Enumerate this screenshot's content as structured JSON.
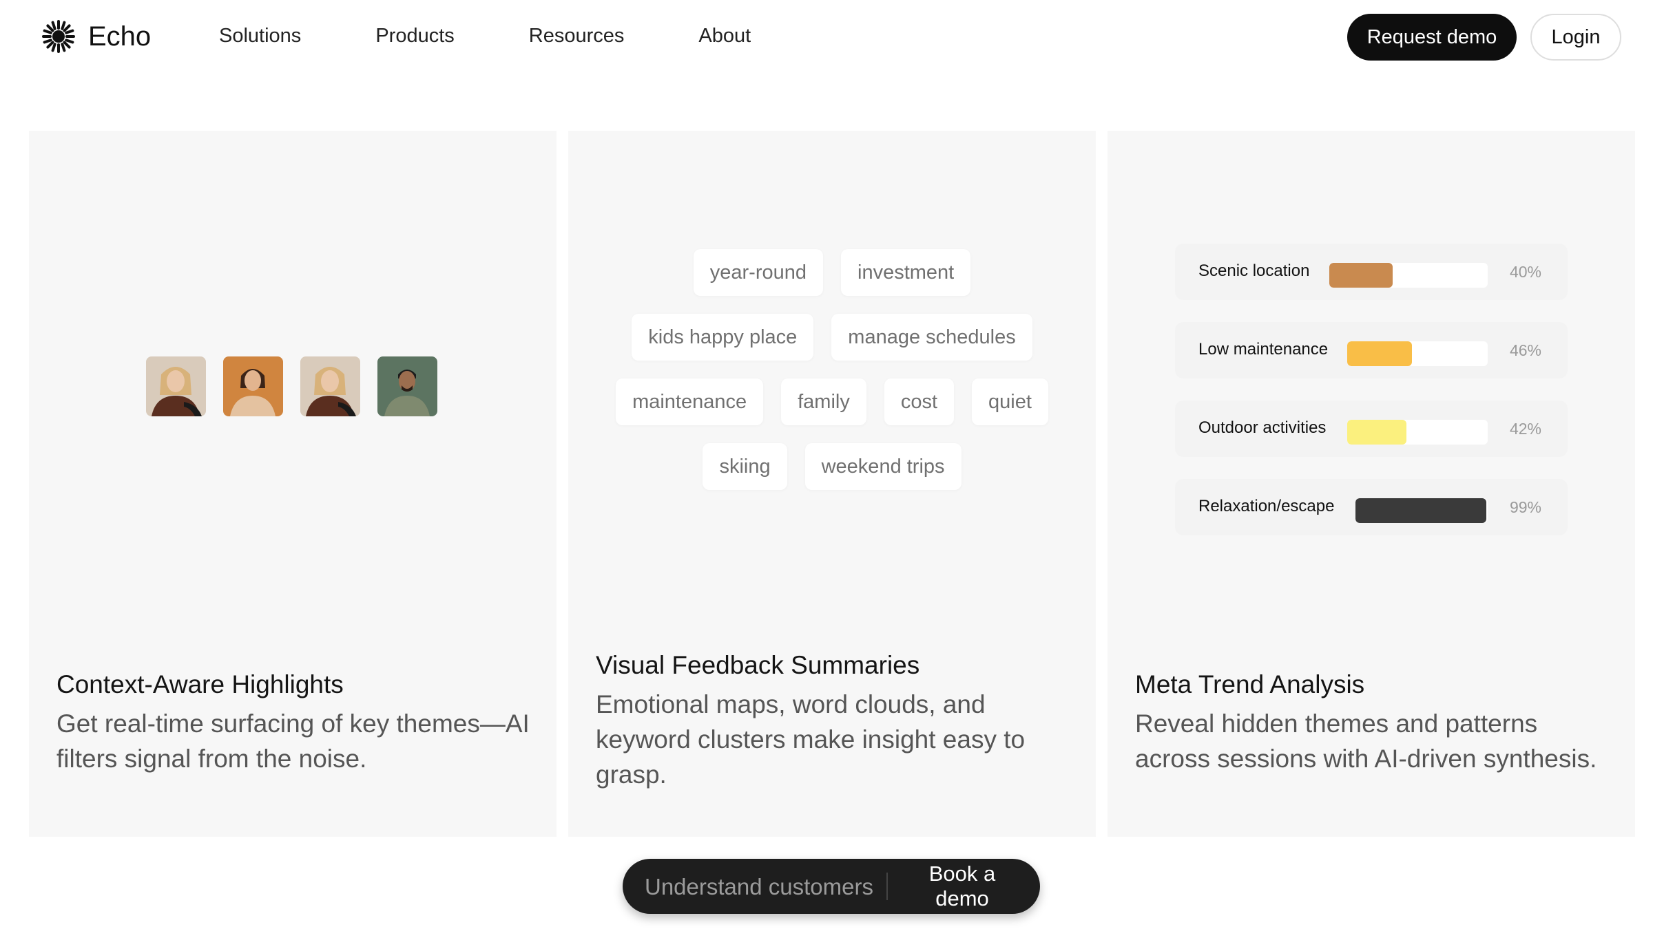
{
  "nav": {
    "brand": "Echo",
    "links": [
      "Solutions",
      "Products",
      "Resources",
      "About"
    ],
    "request_demo": "Request demo",
    "login": "Login"
  },
  "cards": [
    {
      "title": "Context-Aware Highlights",
      "description": "Get real-time surfacing of key themes—AI filters signal from the noise."
    },
    {
      "title": "Visual Feedback Summaries",
      "description": "Emotional maps, word clouds, and keyword clusters make insight easy to grasp.",
      "tags": [
        [
          "year-round",
          "investment"
        ],
        [
          "kids happy place",
          "manage schedules"
        ],
        [
          "maintenance",
          "family",
          "cost",
          "quiet"
        ],
        [
          "skiing",
          "weekend trips"
        ]
      ]
    },
    {
      "title": "Meta Trend Analysis",
      "description": "Reveal hidden themes and patterns across sessions with AI-driven synthesis.",
      "trends": [
        {
          "label": "Scenic location",
          "pct": "40%",
          "value": 40,
          "color": "#c98a4f"
        },
        {
          "label": "Low maintenance",
          "pct": "46%",
          "value": 46,
          "color": "#f9be47"
        },
        {
          "label": "Outdoor activities",
          "pct": "42%",
          "value": 42,
          "color": "#fbf07e"
        },
        {
          "label": "Relaxation/escape",
          "pct": "99%",
          "value": 99,
          "color": "#3a3a3a"
        }
      ]
    }
  ],
  "bottom_bar": {
    "text": "Understand customers",
    "button": "Book a demo"
  },
  "colors": {
    "accent_dark": "#0e0e0e",
    "card_bg": "#f7f7f7"
  }
}
